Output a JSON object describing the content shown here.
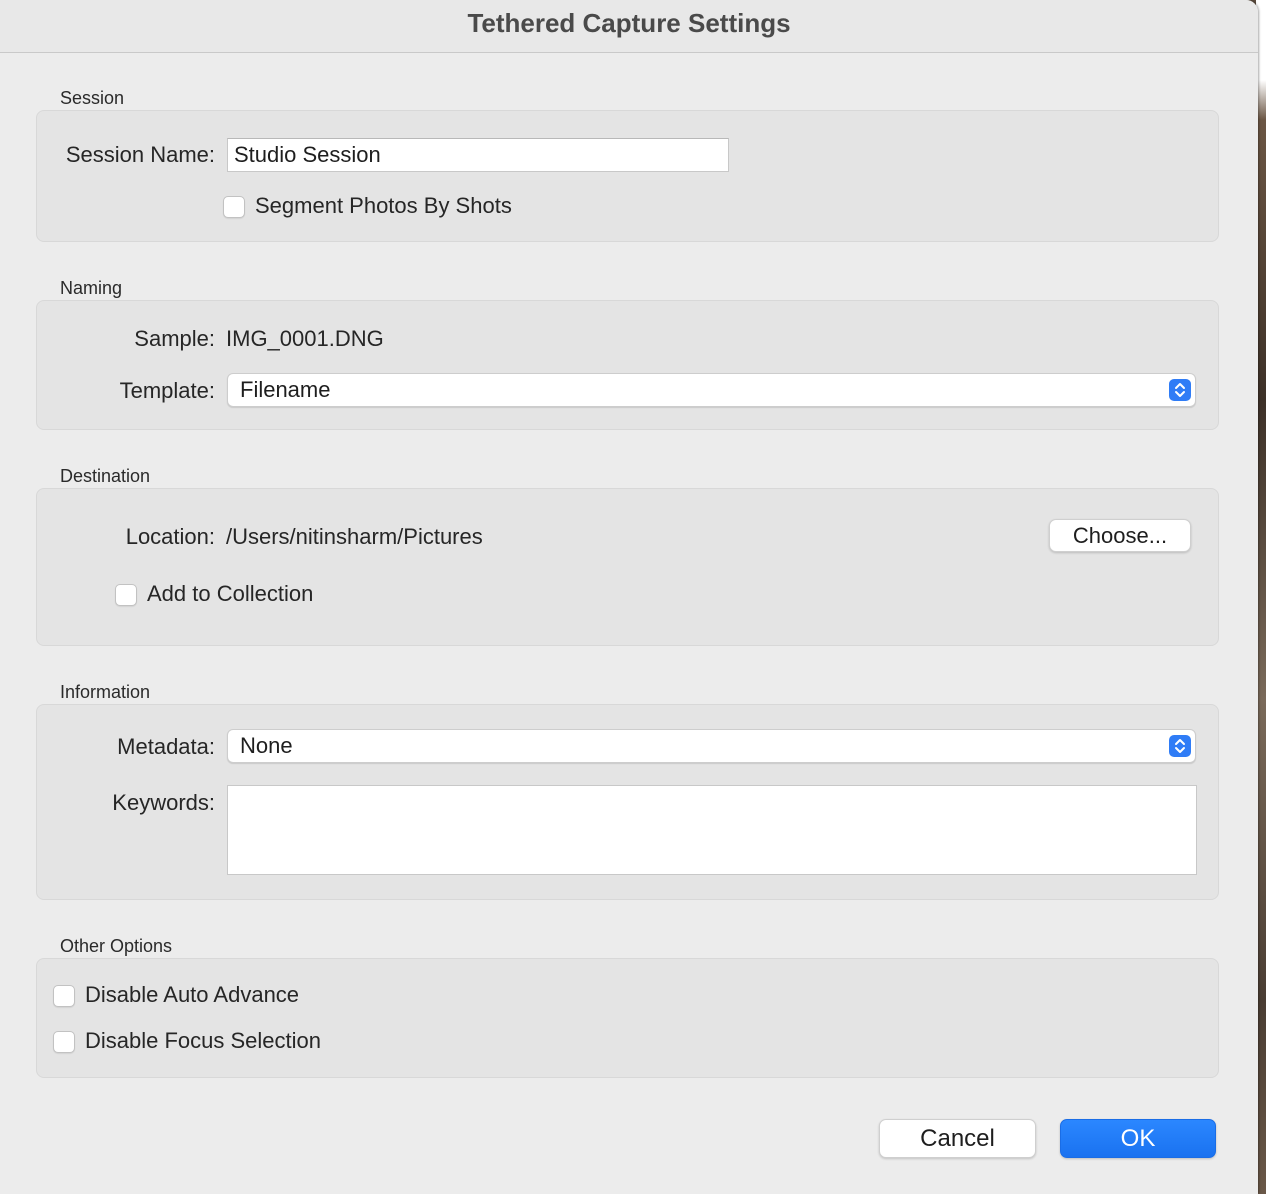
{
  "window": {
    "title": "Tethered Capture Settings"
  },
  "session": {
    "section_label": "Session",
    "name_label": "Session Name:",
    "name_value": "Studio Session",
    "segment_label": "Segment Photos By Shots",
    "segment_checked": false
  },
  "naming": {
    "section_label": "Naming",
    "sample_label": "Sample:",
    "sample_value": "IMG_0001.DNG",
    "template_label": "Template:",
    "template_value": "Filename"
  },
  "destination": {
    "section_label": "Destination",
    "location_label": "Location:",
    "location_value": "/Users/nitinsharm/Pictures",
    "choose_label": "Choose...",
    "add_collection_label": "Add to Collection",
    "add_collection_checked": false
  },
  "information": {
    "section_label": "Information",
    "metadata_label": "Metadata:",
    "metadata_value": "None",
    "keywords_label": "Keywords:",
    "keywords_value": ""
  },
  "other": {
    "section_label": "Other Options",
    "auto_advance_label": "Disable Auto Advance",
    "focus_selection_label": "Disable Focus Selection"
  },
  "buttons": {
    "cancel_label": "Cancel",
    "ok_label": "OK"
  },
  "colors": {
    "accent": "#2f7cf6",
    "dialog_bg": "#ececec",
    "group_bg": "#e4e4e4"
  }
}
